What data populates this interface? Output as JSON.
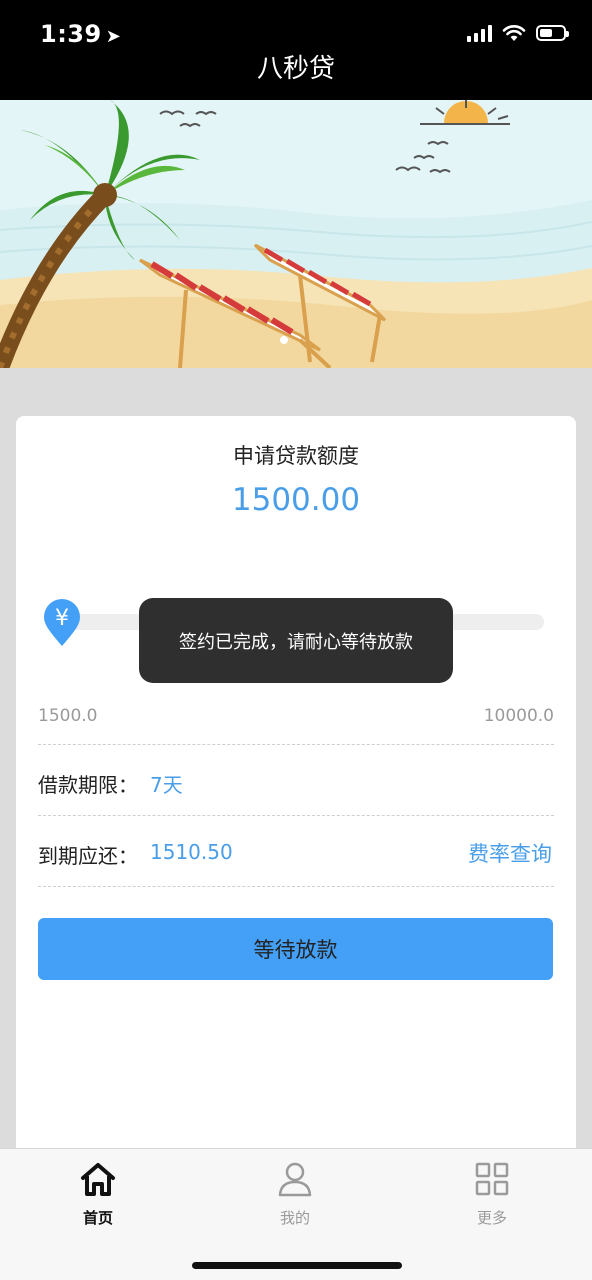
{
  "status_bar": {
    "time": "1:39"
  },
  "header": {
    "title": "八秒贷"
  },
  "loan": {
    "amount_label": "申请贷款额度",
    "amount_value": "1500.00",
    "slider_min": "1500.0",
    "slider_max": "10000.0",
    "term_label": "借款期限：",
    "term_value": "7天",
    "due_label": "到期应还：",
    "due_value": "1510.50",
    "rate_link": "费率查询",
    "action_button": "等待放款"
  },
  "toast": {
    "message": "签约已完成，请耐心等待放款"
  },
  "tab_bar": {
    "items": [
      {
        "label": "首页",
        "icon": "home-icon",
        "active": true
      },
      {
        "label": "我的",
        "icon": "user-icon",
        "active": false
      },
      {
        "label": "更多",
        "icon": "grid-icon",
        "active": false
      }
    ]
  },
  "colors": {
    "accent": "#44a0f6",
    "value_text": "#4a9ee8",
    "toast_bg": "#2f2f2f"
  }
}
